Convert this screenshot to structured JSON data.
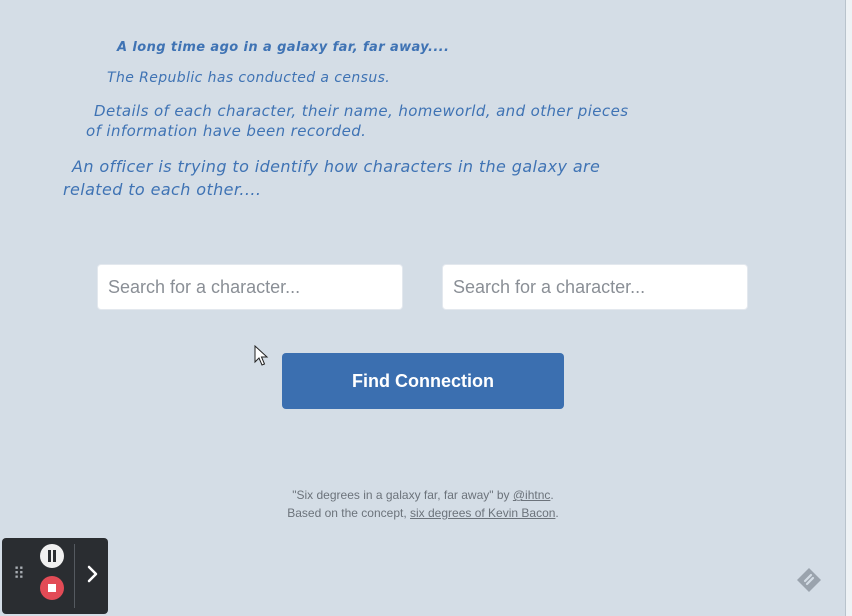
{
  "intro": {
    "line1": "A long time ago in a galaxy far, far away....",
    "line2": "The Republic has conducted a census.",
    "line3a": "Details of each character, their name, homeworld, and other pieces",
    "line3b": "of information have been recorded.",
    "line4a": "An officer is trying to identify how characters in the galaxy are",
    "line4b": "related to each other...."
  },
  "search": {
    "left_placeholder": "Search for a character...",
    "right_placeholder": "Search for a character..."
  },
  "action": {
    "find_label": "Find Connection"
  },
  "footer": {
    "line1_prefix": "\"Six degrees in a galaxy far, far away\" by ",
    "author_link": "@ihtnc",
    "line1_suffix": ".",
    "line2_prefix": "Based on the concept, ",
    "concept_link": "six degrees of Kevin Bacon",
    "line2_suffix": "."
  },
  "recorder": {
    "grip_icon": "drag-handle-icon",
    "pause_icon": "pause-icon",
    "stop_icon": "stop-icon",
    "expand_icon": "chevron-right-icon",
    "stop_color": "#e24b56"
  },
  "colors": {
    "background": "#d4dde6",
    "crawl_text": "#3f73b4",
    "button": "#3b6fb0"
  }
}
